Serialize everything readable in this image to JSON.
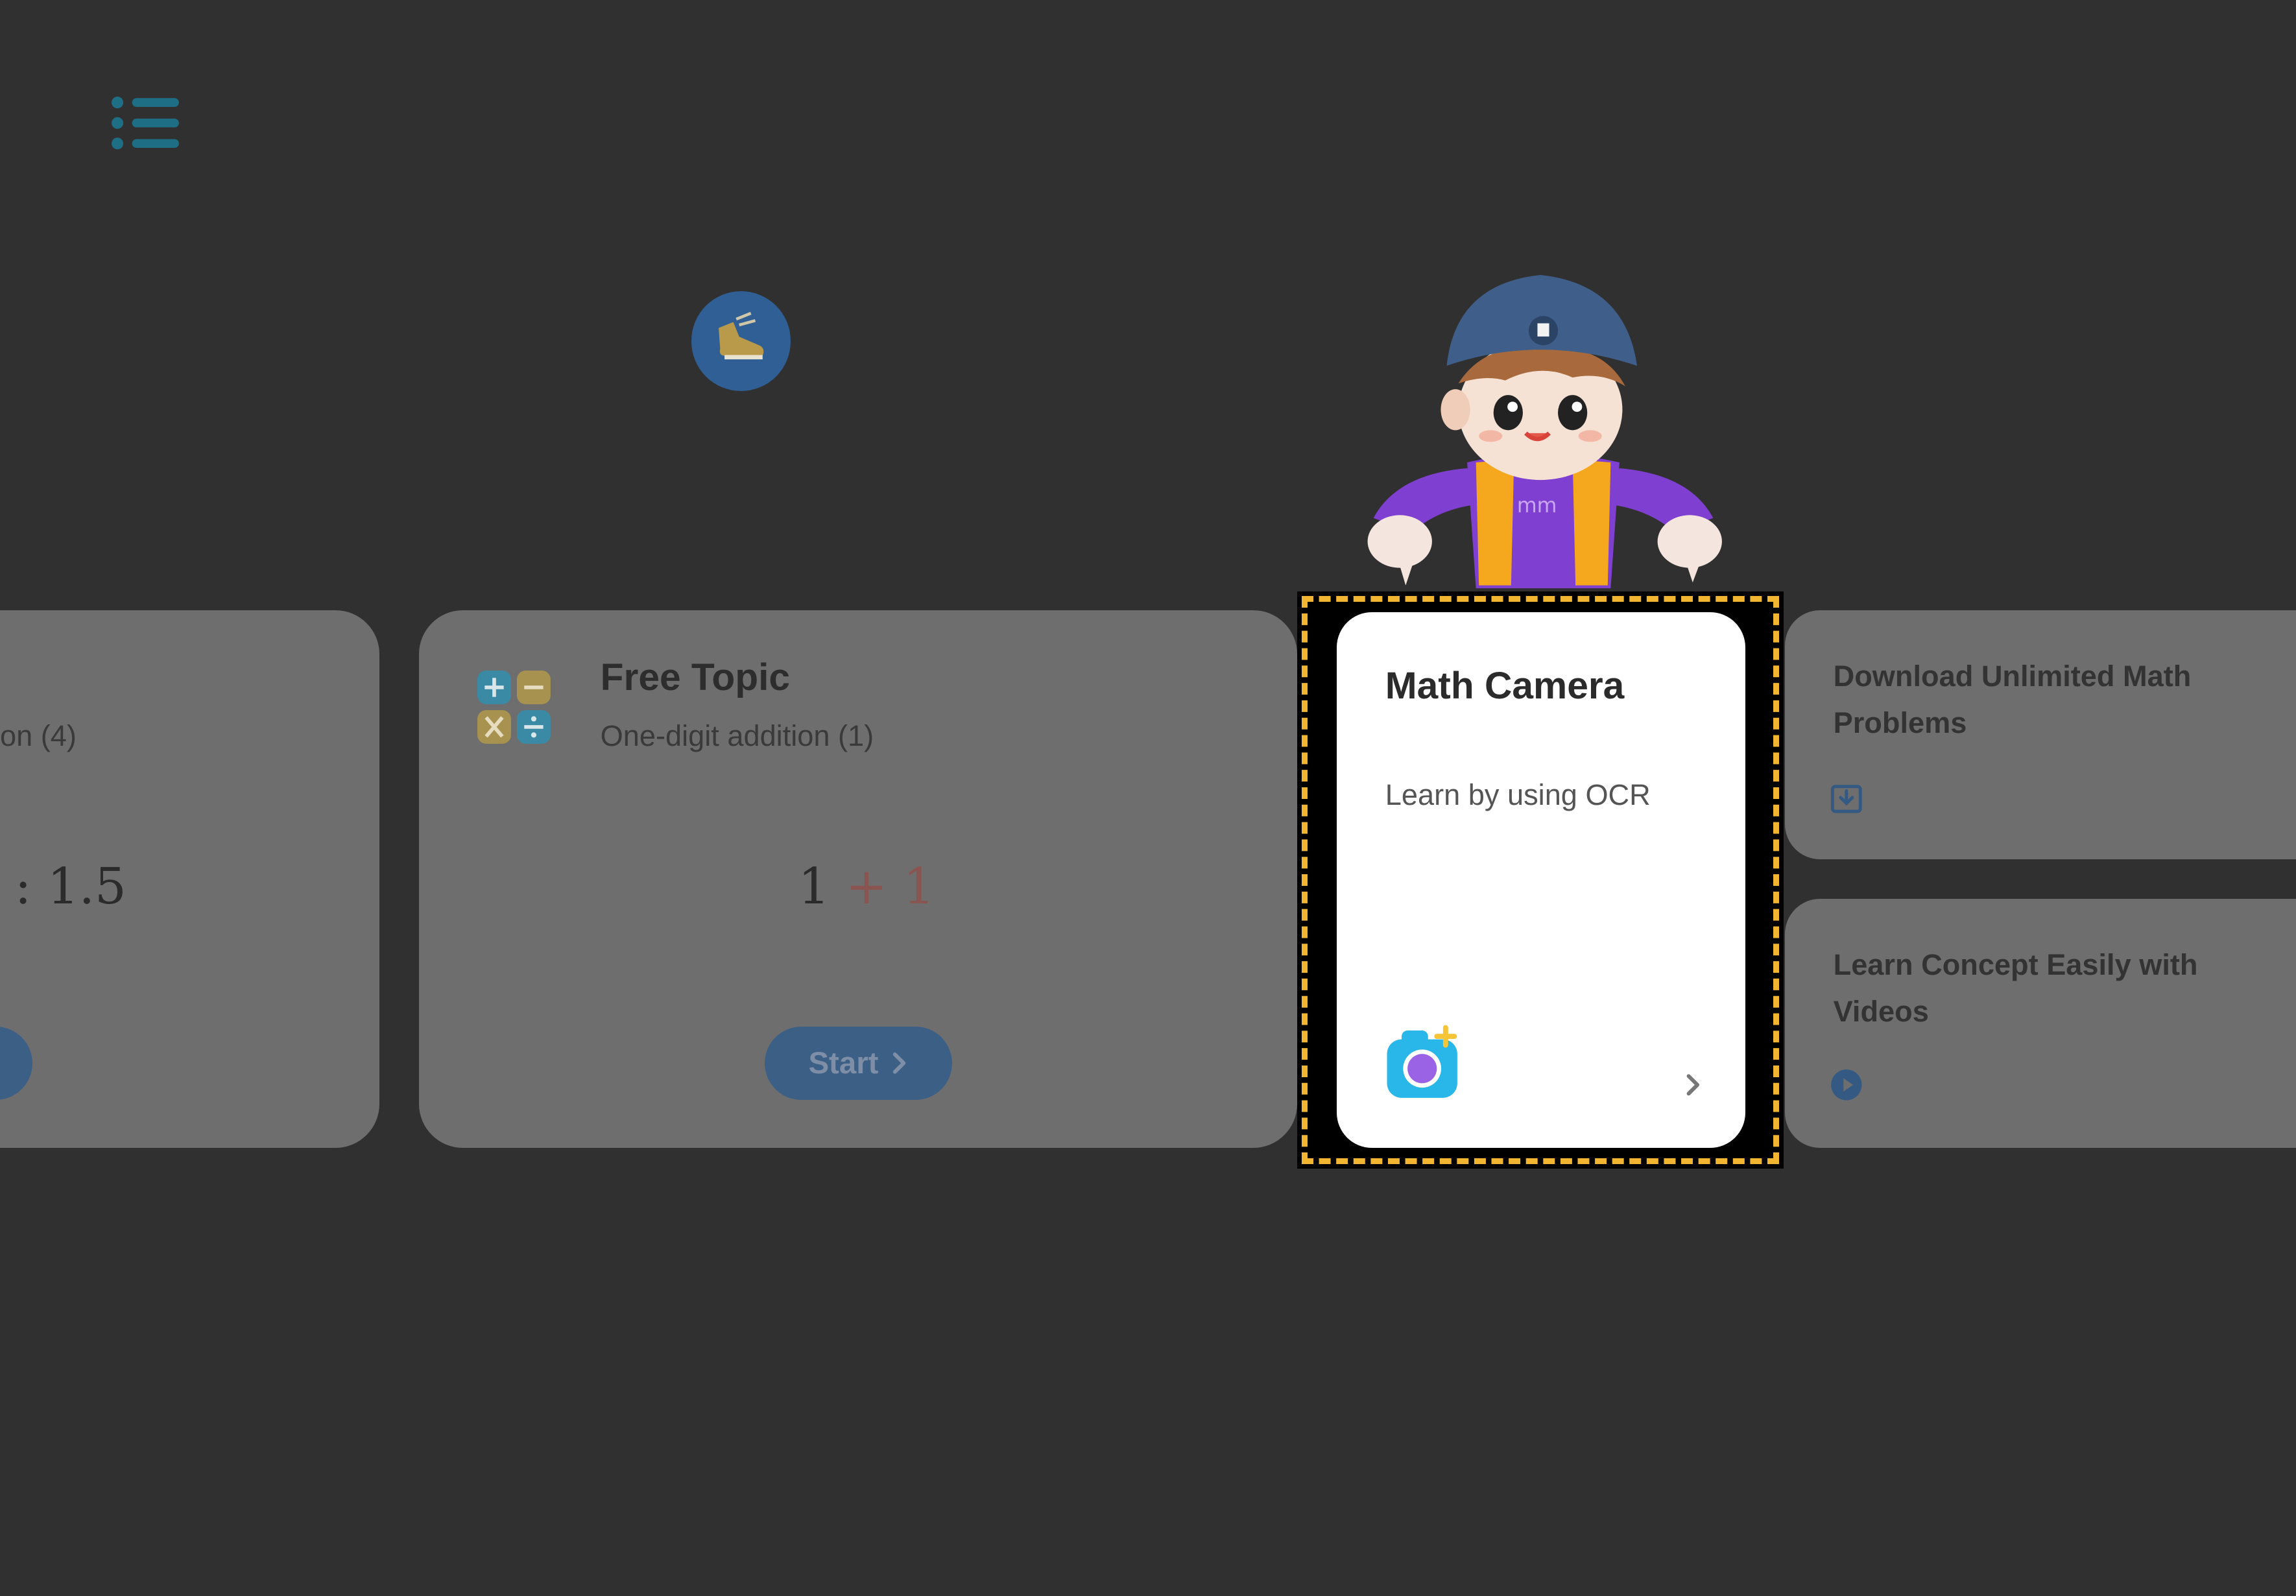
{
  "prev_card": {
    "subtitle": "on (4)",
    "expression": ": 1.5"
  },
  "free_topic": {
    "title": "Free Topic",
    "subtitle": "One-digit addition (1)",
    "expr_left": "1",
    "expr_op": "+",
    "expr_right": "1",
    "start_label": "Start"
  },
  "math_camera": {
    "title": "Math Camera",
    "subtitle": "Learn by using OCR",
    "icon": "camera-icon"
  },
  "download_card": {
    "title": "Download Unlimited Math Problems",
    "icon": "download-icon"
  },
  "video_card": {
    "title": "Learn Concept Easily with Videos",
    "icon": "play-icon"
  },
  "colors": {
    "background": "#303030",
    "highlight_dash": "#f2b531",
    "button": "#3c5f86"
  }
}
